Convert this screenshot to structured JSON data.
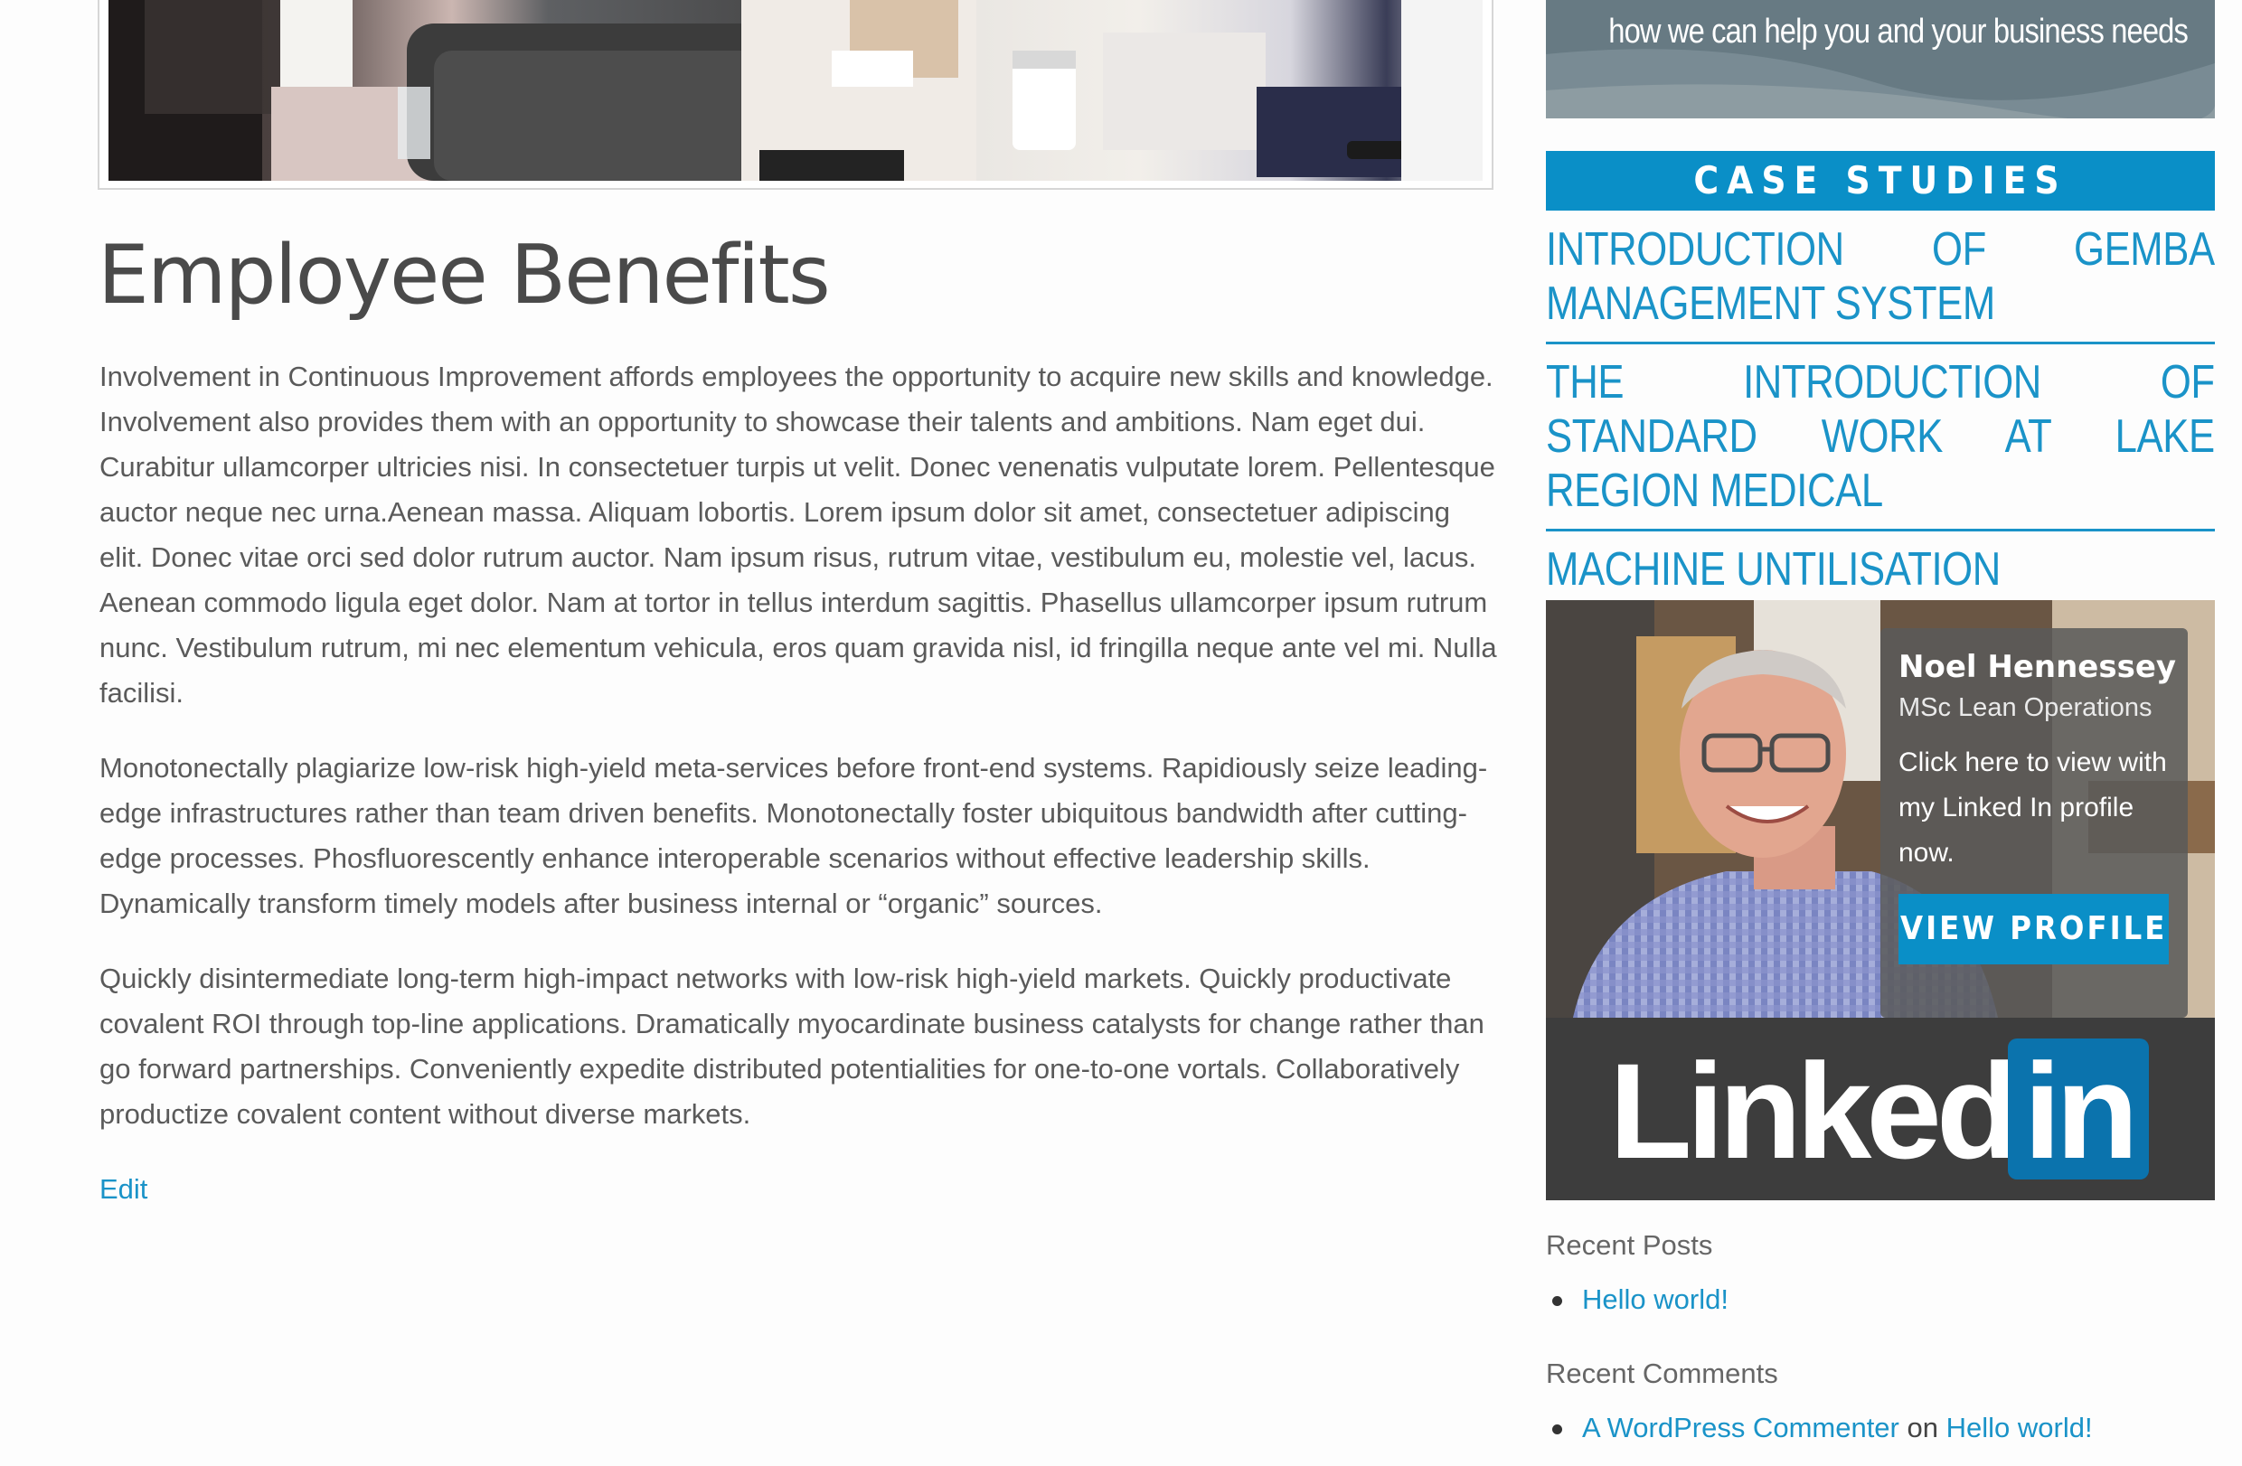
{
  "promo": {
    "text": "how we can help you and your business needs"
  },
  "article": {
    "title": "Employee Benefits",
    "paragraphs": [
      "Involvement in Continuous Improvement affords employees the opportunity to acquire new skills and knowledge. Involvement also provides them with an opportunity to showcase their talents and ambitions. Nam eget dui. Curabitur ullamcorper ultricies nisi. In consectetuer turpis ut velit. Donec venenatis vulputate lorem. Pellentesque auctor neque nec urna.Aenean massa. Aliquam lobortis. Lorem ipsum dolor sit amet, consectetuer adipiscing elit. Donec vitae orci sed dolor rutrum auctor. Nam ipsum risus, rutrum vitae, vestibulum eu, molestie vel, lacus. Aenean commodo ligula eget dolor. Nam at tortor in tellus interdum sagittis. Phasellus ullamcorper ipsum rutrum nunc. Vestibulum rutrum, mi nec elementum vehicula, eros quam gravida nisl, id fringilla neque ante vel mi. Nulla facilisi.",
      "Monotonectally plagiarize low-risk high-yield meta-services before front-end systems. Rapidiously seize leading-edge infrastructures rather than team driven benefits. Monotonectally foster ubiquitous bandwidth after cutting-edge processes. Phosfluorescently enhance interoperable scenarios without effective leadership skills. Dynamically transform timely models after business internal or “organic” sources.",
      "Quickly disintermediate long-term high-impact networks with low-risk high-yield markets. Quickly productivate covalent ROI through top-line applications. Dramatically myocardinate business catalysts for change rather than go forward partnerships. Conveniently expedite distributed potentialities for one-to-one vortals. Collaboratively productize covalent content without diverse markets."
    ],
    "edit_label": "Edit"
  },
  "case_studies": {
    "heading": "CASE STUDIES",
    "items": [
      "INTRODUCTION OF GEMBA MANAGEMENT SYSTEM",
      "THE INTRODUCTION OF STANDARD WORK AT LAKE REGION MEDICAL",
      "MACHINE UNTILISATION"
    ]
  },
  "profile": {
    "name": "Noel Hennessey",
    "title": "MSc Lean Operations",
    "description": "Click here to view with my Linked In profile now.",
    "button_label": "VIEW PROFILE",
    "logo_word": "Linked",
    "logo_box": "in"
  },
  "recent_posts": {
    "heading": "Recent Posts",
    "items": [
      "Hello world!"
    ]
  },
  "recent_comments": {
    "heading": "Recent Comments",
    "author": "A WordPress Commenter",
    "connector": "on",
    "post": "Hello world!"
  },
  "colors": {
    "accent": "#0a8fc7",
    "link": "#1a93c8",
    "linkedin_bar": "#3d3d3d",
    "linkedin_blue": "#0b73ad"
  }
}
